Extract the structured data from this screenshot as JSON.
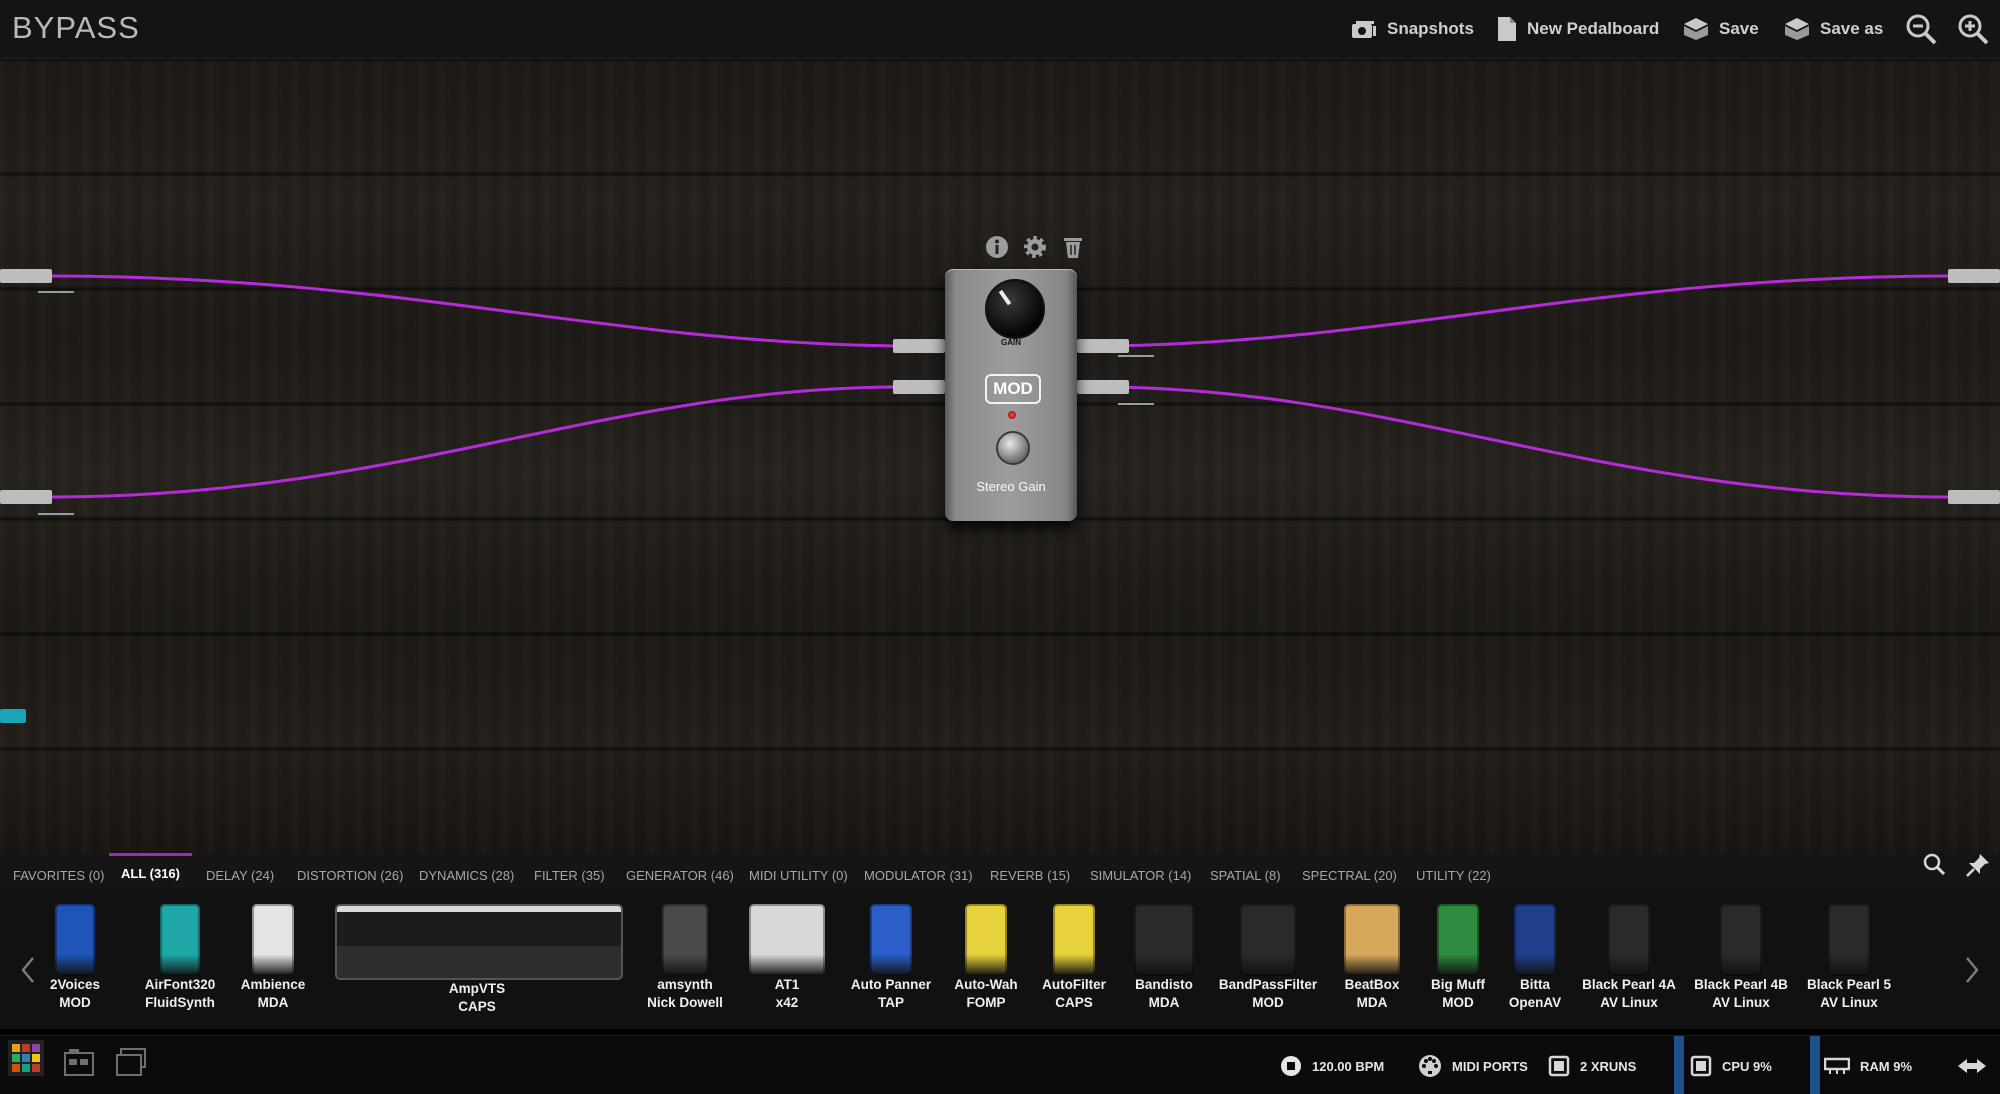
{
  "header": {
    "title": "BYPASS",
    "buttons": {
      "snapshots": "Snapshots",
      "new_pedalboard": "New Pedalboard",
      "save": "Save",
      "save_as": "Save as"
    },
    "icons": [
      "camera-icon",
      "document-icon",
      "box-save-icon",
      "box-save-as-icon",
      "zoom-out-icon",
      "zoom-in-icon"
    ]
  },
  "board": {
    "pedal": {
      "name": "Stereo Gain",
      "knob_label": "GAIN",
      "brand": "MOD",
      "icons": [
        "info-icon",
        "settings-icon",
        "trash-icon"
      ]
    },
    "cable_color": "#b52bd9"
  },
  "tabs": [
    {
      "label": "FAVORITES (0)"
    },
    {
      "label": "ALL (316)",
      "active": true
    },
    {
      "label": "DELAY (24)"
    },
    {
      "label": "DISTORTION (26)"
    },
    {
      "label": "DYNAMICS (28)"
    },
    {
      "label": "FILTER (35)"
    },
    {
      "label": "GENERATOR (46)"
    },
    {
      "label": "MIDI UTILITY (0)"
    },
    {
      "label": "MODULATOR (31)"
    },
    {
      "label": "REVERB (15)"
    },
    {
      "label": "SIMULATOR (14)"
    },
    {
      "label": "SPATIAL (8)"
    },
    {
      "label": "SPECTRAL (20)"
    },
    {
      "label": "UTILITY (22)"
    }
  ],
  "plugins": [
    {
      "name": "2Voices",
      "brand": "MOD",
      "color": "#1f55b8"
    },
    {
      "name": "AirFont320",
      "brand": "FluidSynth",
      "color": "#1fa7a6"
    },
    {
      "name": "Ambience",
      "brand": "MDA",
      "color": "#e4e4e4"
    },
    {
      "name": "AmpVTS",
      "brand": "CAPS",
      "color": "#3a3a3a"
    },
    {
      "name": "amsynth",
      "brand": "Nick Dowell",
      "color": "#4a4a4a"
    },
    {
      "name": "AT1",
      "brand": "x42",
      "color": "#d8d8d8"
    },
    {
      "name": "Auto Panner",
      "brand": "TAP",
      "color": "#2b5ec9"
    },
    {
      "name": "Auto-Wah",
      "brand": "FOMP",
      "color": "#e6d23a"
    },
    {
      "name": "AutoFilter",
      "brand": "CAPS",
      "color": "#e6d23a"
    },
    {
      "name": "Bandisto",
      "brand": "MDA",
      "color": "#2a2a2a"
    },
    {
      "name": "BandPassFilter",
      "brand": "MOD",
      "color": "#2a2a2a"
    },
    {
      "name": "BeatBox",
      "brand": "MDA",
      "color": "#d6a85a"
    },
    {
      "name": "Big Muff",
      "brand": "MOD",
      "color": "#2e8b3f"
    },
    {
      "name": "Bitta",
      "brand": "OpenAV",
      "color": "#1f3f8a"
    },
    {
      "name": "Black Pearl 4A",
      "brand": "AV Linux",
      "color": "#2a2a2a"
    },
    {
      "name": "Black Pearl 4B",
      "brand": "AV Linux",
      "color": "#2a2a2a"
    },
    {
      "name": "Black Pearl 5",
      "brand": "AV Linux",
      "color": "#2a2a2a"
    }
  ],
  "status": {
    "bpm": "120.00 BPM",
    "midi_ports": "MIDI PORTS",
    "xruns": "2 XRUNS",
    "cpu": "CPU 9%",
    "ram": "RAM 9%"
  }
}
